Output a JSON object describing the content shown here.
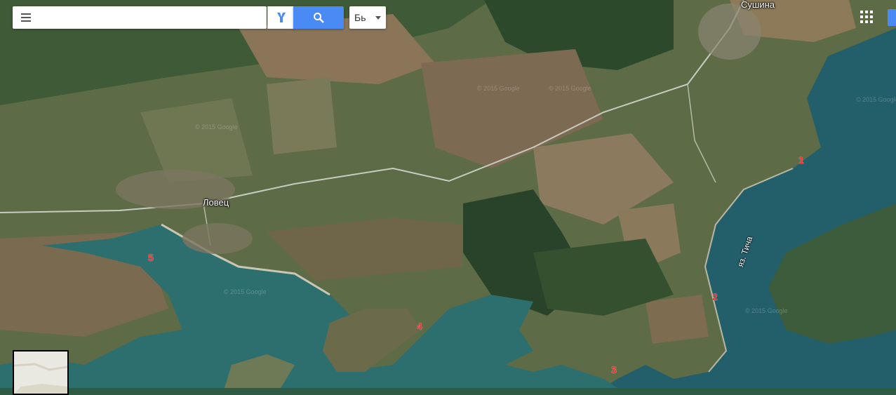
{
  "toolbar": {
    "search_value": "",
    "search_placeholder": "",
    "menu_icon": "hamburger-icon",
    "directions_icon": "directions-icon",
    "search_icon": "search-icon",
    "language_value": "Бь",
    "apps_icon": "apps-grid-icon"
  },
  "map": {
    "places": {
      "village_lovets": "Ловец",
      "village_sushina": "Сушина",
      "lake_ticha": "яз. Тича"
    },
    "watermark": "© 2015 Google",
    "markers": [
      "1",
      "2",
      "3",
      "4",
      "5"
    ]
  },
  "colors": {
    "water": "#2d6f6f",
    "deep_water": "#1e5863",
    "land": "#5b6a45",
    "fields": "#8a7a5b",
    "forest": "#2e4a2c",
    "marker": "#ff2a2a",
    "accent": "#4a8af4"
  }
}
